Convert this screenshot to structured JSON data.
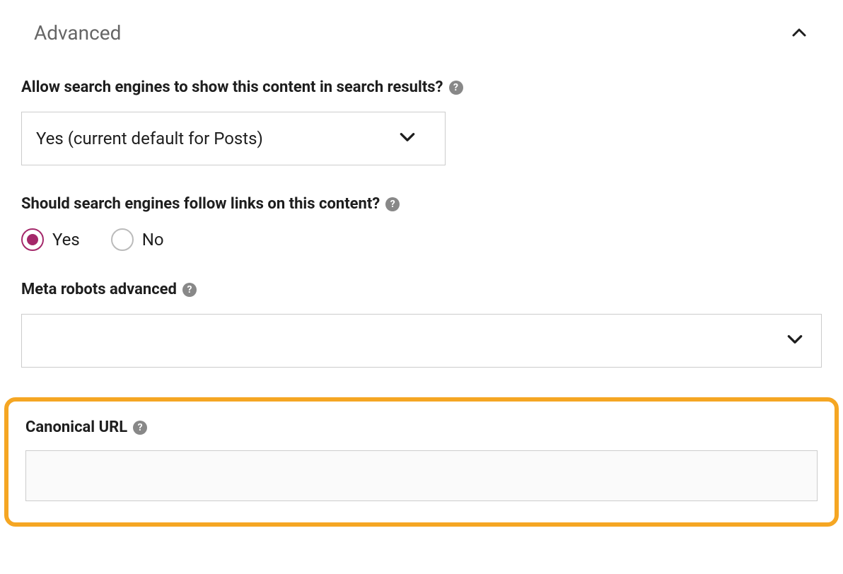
{
  "panel": {
    "title": "Advanced"
  },
  "fields": {
    "allow_search": {
      "label": "Allow search engines to show this content in search results?",
      "value": "Yes (current default for Posts)"
    },
    "follow_links": {
      "label": "Should search engines follow links on this content?",
      "options": {
        "yes": "Yes",
        "no": "No"
      },
      "selected": "yes"
    },
    "meta_robots": {
      "label": "Meta robots advanced",
      "value": ""
    },
    "canonical": {
      "label": "Canonical URL",
      "value": ""
    }
  }
}
